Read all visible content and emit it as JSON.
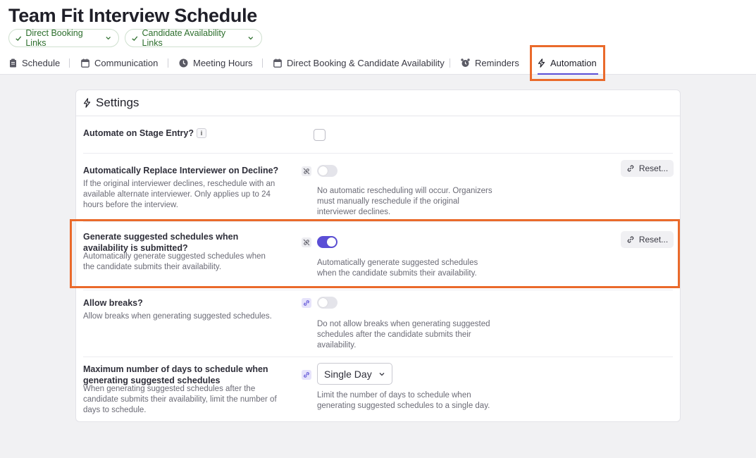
{
  "page": {
    "title": "Team Fit Interview Schedule"
  },
  "pills": [
    {
      "label": "Direct Booking Links"
    },
    {
      "label": "Candidate Availability Links"
    }
  ],
  "tabs": [
    {
      "label": "Schedule",
      "icon": "clipboard-icon"
    },
    {
      "label": "Communication",
      "icon": "calendar-icon"
    },
    {
      "label": "Meeting Hours",
      "icon": "clock-icon"
    },
    {
      "label": "Direct Booking & Candidate Availability",
      "icon": "calendar-icon"
    },
    {
      "label": "Reminders",
      "icon": "alarm-clock-icon"
    },
    {
      "label": "Automation",
      "icon": "lightning-bolt-icon",
      "active": true
    }
  ],
  "settings": {
    "title": "Settings",
    "rows": [
      {
        "label": "Automate on Stage Entry?",
        "info": "i",
        "control": "checkbox",
        "checked": false
      },
      {
        "label": "Automatically Replace Interviewer on Decline?",
        "description": "If the original interviewer declines, reschedule with an available alternate interviewer. Only applies up to 24 hours before the interview.",
        "control": "toggle",
        "enabled": false,
        "linked": false,
        "value_description": "No automatic rescheduling will occur. Organizers must manually reschedule if the original interviewer declines.",
        "reset_label": "Reset..."
      },
      {
        "label": "Generate suggested schedules when availability is submitted?",
        "description": "Automatically generate suggested schedules when the candidate submits their availability.",
        "control": "toggle",
        "enabled": true,
        "linked": false,
        "value_description": "Automatically generate suggested schedules when the candidate submits their availability.",
        "reset_label": "Reset..."
      },
      {
        "label": "Allow breaks?",
        "description": "Allow breaks when generating suggested schedules.",
        "control": "toggle",
        "enabled": false,
        "linked": true,
        "value_description": "Do not allow breaks when generating suggested schedules after the candidate submits their availability."
      },
      {
        "label": "Maximum number of days to schedule when generating suggested schedules",
        "description": "When generating suggested schedules after the candidate submits their availability, limit the number of days to schedule.",
        "control": "select",
        "linked": true,
        "selected": "Single Day",
        "value_description": "Limit the number of days to schedule when generating suggested schedules to a single day."
      }
    ]
  },
  "colors": {
    "accent": "#5b4fd6",
    "highlight": "#ea6a2b",
    "pill_text": "#2c6e2c"
  }
}
